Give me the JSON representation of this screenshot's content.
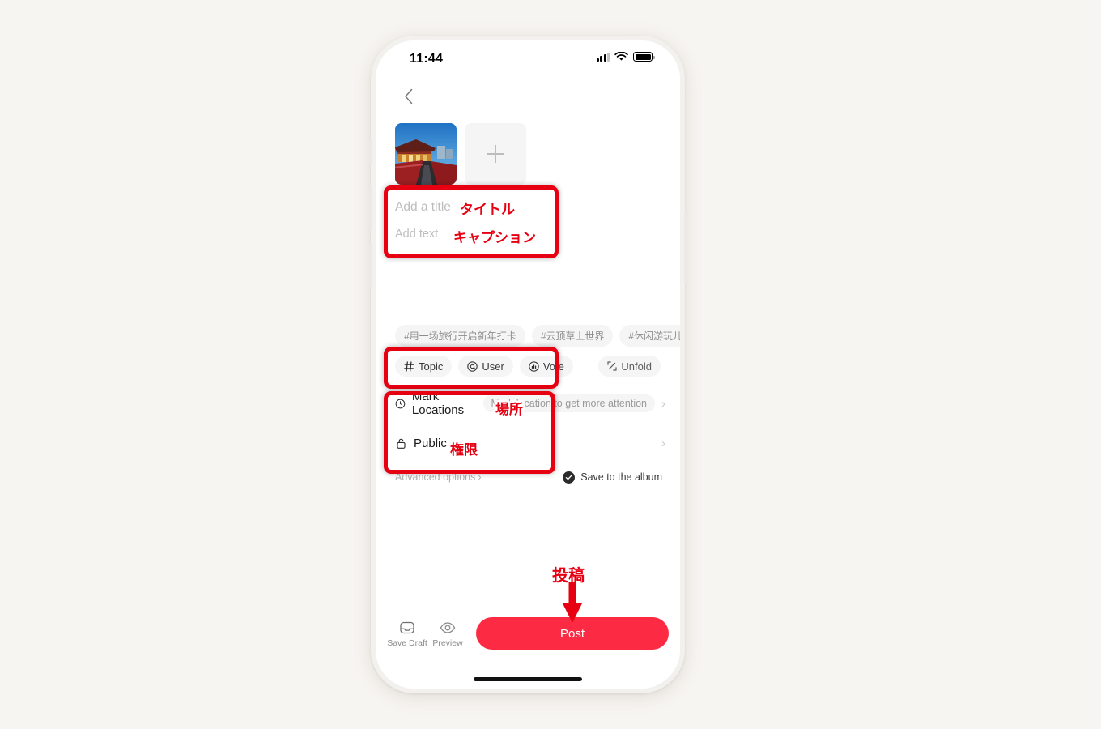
{
  "background_color": "#f7f5f1",
  "accent_color": "#fc2b43",
  "annotation_color": "#e60012",
  "status_bar": {
    "time": "11:44",
    "signal_icon": "signal-bars-icon",
    "wifi_icon": "wifi-icon",
    "battery_icon": "battery-icon"
  },
  "nav": {
    "back_icon": "chevron-left-icon"
  },
  "media": {
    "thumbnail_alt": "temple-photo-thumbnail",
    "add_label": "+",
    "add_icon": "plus-icon"
  },
  "compose": {
    "title_placeholder": "Add a title",
    "caption_placeholder": "Add text"
  },
  "topic_tags": [
    "#用一场旅行开启新年打卡",
    "#云顶草上世界",
    "#休闲游玩儿",
    "#"
  ],
  "insert_toolbar": {
    "items": [
      {
        "label": "Topic",
        "icon": "hash-icon"
      },
      {
        "label": "User",
        "icon": "at-icon"
      },
      {
        "label": "Vote",
        "icon": "vote-icon"
      }
    ],
    "unfold_label": "Unfold",
    "unfold_icon": "unfold-icon"
  },
  "options": {
    "location": {
      "label": "Mark Locations",
      "icon": "location-pin-icon",
      "hint": "Mark location to get more attention",
      "chevron": "›"
    },
    "privacy": {
      "label": "Public",
      "icon": "lock-icon",
      "chevron": "›"
    }
  },
  "advanced": {
    "label": "Advanced options",
    "chevron": "›",
    "save_album_label": "Save to the album",
    "save_album_checked": true,
    "check_icon": "check-icon"
  },
  "bottom_bar": {
    "save_draft_label": "Save Draft",
    "save_draft_icon": "inbox-tray-icon",
    "preview_label": "Preview",
    "preview_icon": "eye-icon",
    "post_label": "Post"
  },
  "annotations": {
    "title": "タイトル",
    "caption": "キャプション",
    "place": "場所",
    "permission": "権限",
    "post": "投稿"
  }
}
